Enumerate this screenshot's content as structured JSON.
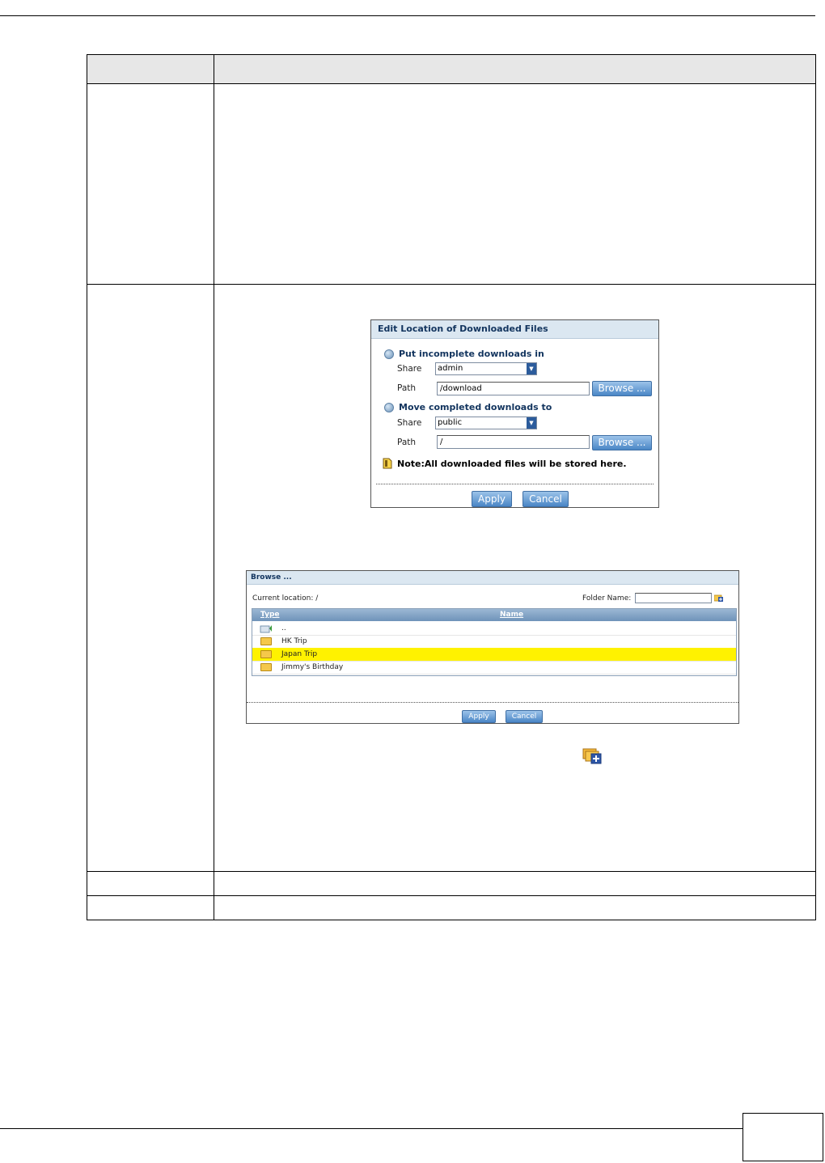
{
  "browse_dialog": {
    "title": "Browse ...",
    "current_location_label": "Current location: /",
    "folder_name_label": "Folder Name:",
    "col_type": "Type",
    "col_name": "Name",
    "rows": [
      {
        "name": "..",
        "icon": "parent-folder-icon"
      },
      {
        "name": "HK Trip",
        "icon": "folder-icon"
      },
      {
        "name": "Japan Trip",
        "icon": "folder-icon",
        "selected": true
      },
      {
        "name": "Jimmy's Birthday",
        "icon": "folder-icon"
      }
    ],
    "apply_label": "Apply",
    "cancel_label": "Cancel"
  },
  "colors": {
    "dialog_title_bg": "#dbe7f1",
    "dialog_title_text": "#12345e",
    "button_blue": "#4a86c6",
    "selected_row": "#fff200",
    "header_row": "#e7e7e7"
  },
  "edit_dialog": {
    "title": "Edit Location of Downloaded Files",
    "incomplete_heading": "Put incomplete downloads in",
    "completed_heading": "Move completed downloads to",
    "share_label": "Share",
    "path_label": "Path",
    "incomplete_share": "admin",
    "incomplete_path": "/download",
    "completed_share": "public",
    "completed_path": "/",
    "browse_label": "Browse ...",
    "note": "Note:All downloaded files will be stored here.",
    "apply_label": "Apply",
    "cancel_label": "Cancel"
  }
}
